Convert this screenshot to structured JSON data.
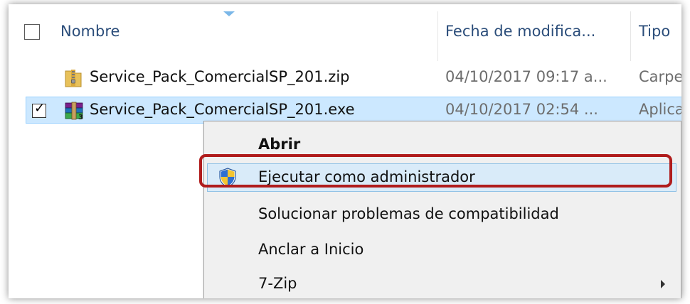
{
  "columns": {
    "name": "Nombre",
    "date": "Fecha de modifica...",
    "type": "Tipo"
  },
  "files": [
    {
      "name": "Service_Pack_ComercialSP_201.zip",
      "date": "04/10/2017 09:17 a...",
      "type": "Carpet",
      "icon": "zip-folder-icon",
      "selected": false
    },
    {
      "name": "Service_Pack_ComercialSP_201.exe",
      "date": "04/10/2017 02:54 ...",
      "type": "Aplica",
      "icon": "winrar-icon",
      "selected": true,
      "checked": true
    }
  ],
  "context_menu": {
    "items": [
      {
        "label": "Abrir",
        "bold": true
      },
      {
        "label": "Ejecutar como administrador",
        "icon": "uac-shield-icon",
        "highlighted": true
      },
      {
        "label": "Solucionar problemas de compatibilidad"
      },
      {
        "label": "Anclar a Inicio"
      },
      {
        "label": "7-Zip",
        "submenu": true
      }
    ]
  },
  "colors": {
    "selection_bg": "#cce8ff",
    "menu_hover_bg": "#d9ebf9",
    "annotation_red": "#b01c1c",
    "header_text": "#2b4d7a"
  }
}
